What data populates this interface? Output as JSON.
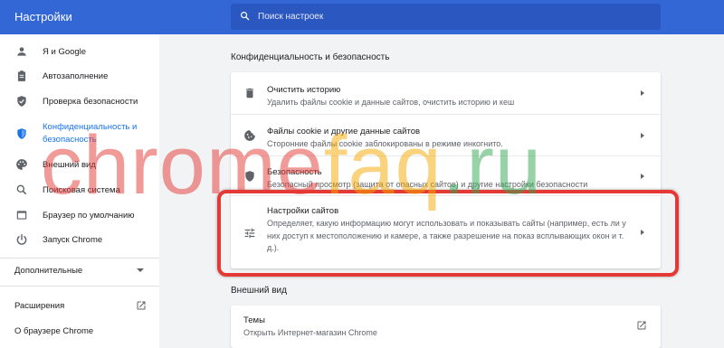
{
  "header": {
    "title": "Настройки",
    "search_placeholder": "Поиск настроек"
  },
  "sidebar": {
    "items": [
      {
        "label": "Я и Google",
        "icon": "person-icon"
      },
      {
        "label": "Автозаполнение",
        "icon": "clipboard-icon"
      },
      {
        "label": "Проверка безопасности",
        "icon": "shield-check-icon"
      },
      {
        "label": "Конфиденциальность и безопасность",
        "icon": "shield-icon",
        "active": true
      },
      {
        "label": "Внешний вид",
        "icon": "palette-icon"
      },
      {
        "label": "Поисковая система",
        "icon": "search-icon"
      },
      {
        "label": "Браузер по умолчанию",
        "icon": "browser-icon"
      },
      {
        "label": "Запуск Chrome",
        "icon": "power-icon"
      }
    ],
    "active_line1": "Конфиденциальность и",
    "active_line2": "безопасность",
    "advanced_label": "Дополнительные",
    "extensions_label": "Расширения",
    "about_label": "О браузере Chrome"
  },
  "privacy": {
    "section_title": "Конфиденциальность и безопасность",
    "rows": [
      {
        "title": "Очистить историю",
        "subtitle": "Удалить файлы cookie и данные сайтов, очистить историю и кеш",
        "icon": "trash-icon"
      },
      {
        "title": "Файлы cookie и другие данные сайтов",
        "subtitle": "Сторонние файлы cookie заблокированы в режиме инкогнито.",
        "icon": "cookie-icon"
      },
      {
        "title": "Безопасность",
        "subtitle": "Безопасный просмотр (защита от опасных сайтов) и другие настройки безопасности",
        "icon": "shield-icon"
      },
      {
        "title": "Настройки сайтов",
        "subtitle": "Определяет, какую информацию могут использовать и показывать сайты (например, есть ли у них доступ к местоположению и камере, а также разрешение на показ всплывающих окон и т. д.).",
        "icon": "tune-icon"
      }
    ]
  },
  "appearance": {
    "section_title": "Внешний вид",
    "themes_title": "Темы",
    "themes_subtitle": "Открыть Интернет-магазин Chrome"
  },
  "watermark": {
    "part1": "chrome",
    "part2": "faq",
    "part3": ".ru",
    "colors": [
      "#e53935",
      "#f6a800",
      "#34a853"
    ]
  },
  "colors": {
    "header": "#3367d6",
    "accent": "#1a73e8",
    "highlight": "#e53935"
  }
}
